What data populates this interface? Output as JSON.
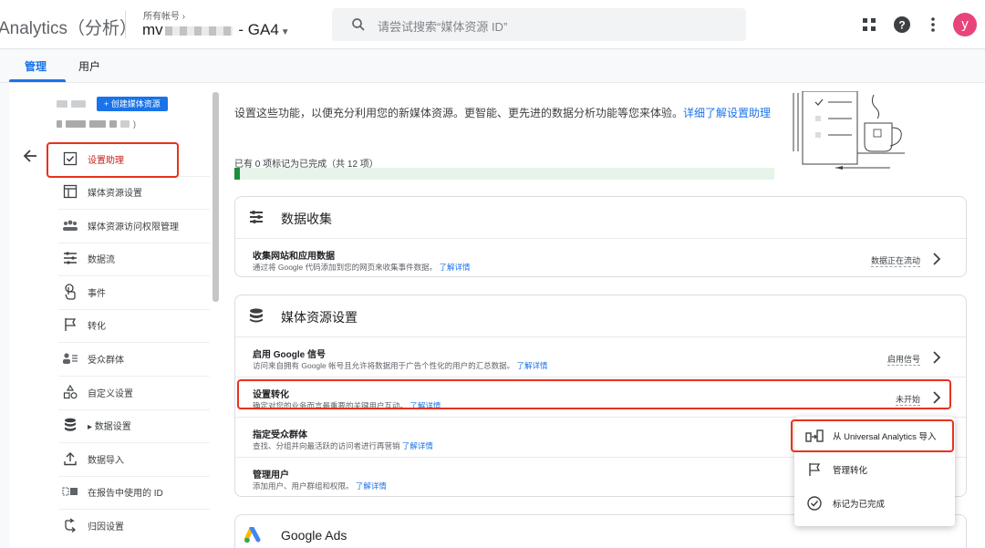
{
  "header": {
    "app_title": "Analytics（分析）",
    "account_crumb": "所有帐号 ›",
    "property_prefix": "mv",
    "property_suffix": "‌ - GA4",
    "search_placeholder": "请尝试搜索“媒体资源 ID”",
    "avatar_letter": "y"
  },
  "tabs": [
    {
      "label": "管理"
    },
    {
      "label": "用户"
    }
  ],
  "sidebar": {
    "create_button": "+ 创建媒体资源",
    "account_tail": ")",
    "items": [
      {
        "label": "设置助理",
        "icon": "checklist-icon"
      },
      {
        "label": "媒体资源设置",
        "icon": "property-icon"
      },
      {
        "label": "媒体资源访问权限管理",
        "icon": "people-icon"
      },
      {
        "label": "数据流",
        "icon": "streams-icon"
      },
      {
        "label": "事件",
        "icon": "touch-icon"
      },
      {
        "label": "转化",
        "icon": "flag-icon"
      },
      {
        "label": "受众群体",
        "icon": "audience-icon"
      },
      {
        "label": "自定义设置",
        "icon": "shapes-icon"
      },
      {
        "label": "▸ 数据设置",
        "icon": "database-icon"
      },
      {
        "label": "数据导入",
        "icon": "upload-icon"
      },
      {
        "label": "在报告中使用的 ID",
        "icon": "id-icon"
      },
      {
        "label": "归因设置",
        "icon": "attribution-icon"
      }
    ]
  },
  "intro": {
    "text": "设置这些功能，以便充分利用您的新媒体资源。更智能、更先进的数据分析功能等您来体验。",
    "link": "详细了解设置助理"
  },
  "progress": {
    "label": "已有 0 项标记为已完成（共 12 项）",
    "completed": 0,
    "total": 12
  },
  "sections": [
    {
      "title": "数据收集",
      "icon": "data-collection-icon",
      "rows": [
        {
          "title": "收集网站和应用数据",
          "desc": "通过将 Google 代码添加到您的网页来收集事件数据。",
          "link": "了解详情",
          "status": "数据正在流动"
        }
      ]
    },
    {
      "title": "媒体资源设置",
      "icon": "database-icon",
      "rows": [
        {
          "title": "启用 Google 信号",
          "desc": "访问来自拥有 Google 帐号且允许将数据用于广告个性化的用户的汇总数据。",
          "link": "了解详情",
          "status": "启用信号"
        },
        {
          "title": "设置转化",
          "desc": "确定对您的业务而言最重要的关键用户互动。",
          "link": "了解详情",
          "status": "未开始"
        },
        {
          "title": "指定受众群体",
          "desc": "查找、分组并向最活跃的访问者进行再营销",
          "link": "了解详情",
          "status": ""
        },
        {
          "title": "管理用户",
          "desc": "添加用户、用户群组和权限。",
          "link": "了解详情",
          "status": ""
        }
      ]
    },
    {
      "title": "Google Ads",
      "icon": "google-ads-icon",
      "rows": []
    }
  ],
  "popup_menu": [
    {
      "label": "从 Universal Analytics 导入",
      "icon": "import-icon"
    },
    {
      "label": "管理转化",
      "icon": "flag-icon"
    },
    {
      "label": "标记为已完成",
      "icon": "check-circle-icon"
    }
  ],
  "colors": {
    "accent": "#1a73e8",
    "highlight_red": "#e8321d",
    "progress_green": "#1e8e3e"
  }
}
